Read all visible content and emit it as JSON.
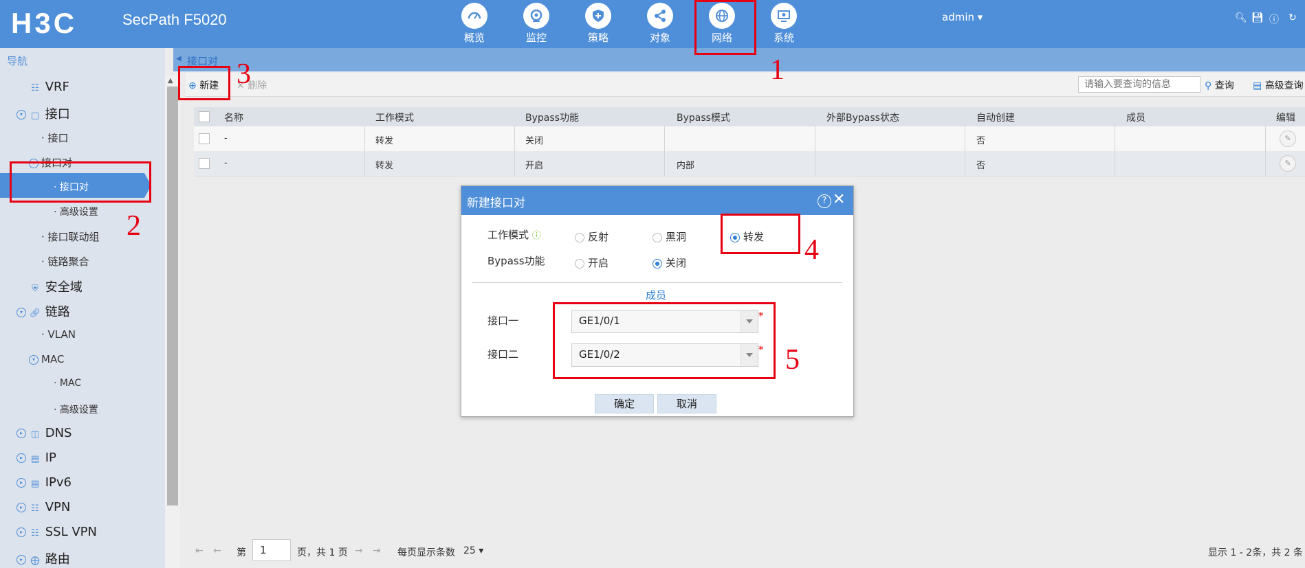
{
  "header": {
    "logo": "H3C",
    "product": "SecPath F5020",
    "nav": [
      {
        "label": "概览",
        "icon": "dashboard-icon"
      },
      {
        "label": "监控",
        "icon": "monitor-icon"
      },
      {
        "label": "策略",
        "icon": "shield-plus-icon"
      },
      {
        "label": "对象",
        "icon": "share-nodes-icon"
      },
      {
        "label": "网络",
        "icon": "globe-icon"
      },
      {
        "label": "系统",
        "icon": "display-gear-icon"
      }
    ],
    "user": "admin"
  },
  "sidebar": {
    "title": "导航",
    "items": [
      {
        "label": "VRF"
      },
      {
        "label": "接口"
      },
      {
        "label": "接口"
      },
      {
        "label": "接口对"
      },
      {
        "label": "接口对"
      },
      {
        "label": "高级设置"
      },
      {
        "label": "接口联动组"
      },
      {
        "label": "链路聚合"
      },
      {
        "label": "安全域"
      },
      {
        "label": "链路"
      },
      {
        "label": "VLAN"
      },
      {
        "label": "MAC"
      },
      {
        "label": "MAC"
      },
      {
        "label": "高级设置"
      },
      {
        "label": "DNS"
      },
      {
        "label": "IP"
      },
      {
        "label": "IPv6"
      },
      {
        "label": "VPN"
      },
      {
        "label": "SSL VPN"
      },
      {
        "label": "路由"
      }
    ]
  },
  "breadcrumb": "接口对",
  "toolbar": {
    "new_label": "新建",
    "delete_label": "删除",
    "search_placeholder": "请输入要查询的信息",
    "query_label": "查询",
    "advanced_query_label": "高级查询"
  },
  "table": {
    "columns": [
      "名称",
      "工作模式",
      "Bypass功能",
      "Bypass模式",
      "外部Bypass状态",
      "自动创建",
      "成员",
      "编辑"
    ],
    "rows": [
      {
        "name": "-",
        "mode": "转发",
        "bypass": "关闭",
        "bypass_mode": "",
        "ext_bypass": "",
        "auto": "否",
        "members": ""
      },
      {
        "name": "-",
        "mode": "转发",
        "bypass": "开启",
        "bypass_mode": "内部",
        "ext_bypass": "",
        "auto": "否",
        "members": ""
      }
    ]
  },
  "pager": {
    "prefix": "第",
    "page": "1",
    "suffix": "页，共 1 页",
    "per_page_label": "每页显示条数",
    "per_page": "25",
    "summary": "显示 1 - 2条，共 2 条"
  },
  "dialog": {
    "title": "新建接口对",
    "mode_label": "工作模式",
    "mode_options": [
      "反射",
      "黑洞",
      "转发"
    ],
    "mode_selected": "转发",
    "bypass_label": "Bypass功能",
    "bypass_options": [
      "开启",
      "关闭"
    ],
    "bypass_selected": "关闭",
    "members_title": "成员",
    "iface1_label": "接口一",
    "iface1_value": "GE1/0/1",
    "iface2_label": "接口二",
    "iface2_value": "GE1/0/2",
    "required_mark": "*",
    "ok_label": "确定",
    "cancel_label": "取消"
  },
  "annotations": [
    "1",
    "2",
    "3",
    "4",
    "5"
  ],
  "colors": {
    "accent": "#4f8fd9",
    "annotation": "#e60012",
    "header_bg": "#4f8fd9"
  }
}
